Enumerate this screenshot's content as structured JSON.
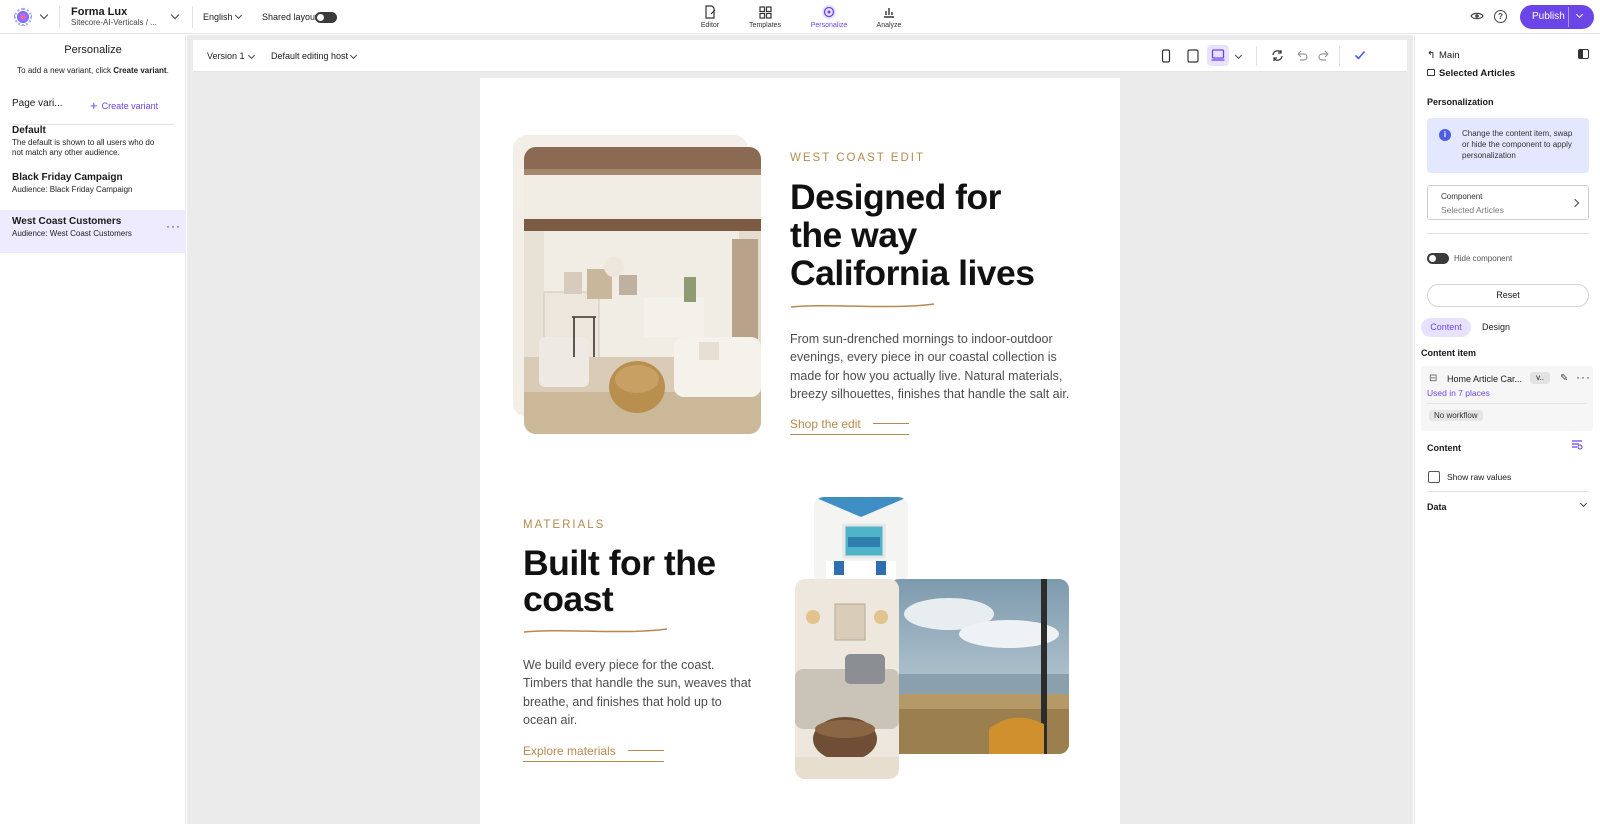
{
  "topbar": {
    "site_name": "Forma Lux",
    "site_path": "Sitecore-AI-Verticals / ...",
    "language": "English",
    "shared_layout_label": "Shared layout",
    "nav": [
      {
        "label": "Editor",
        "icon": "editor-icon"
      },
      {
        "label": "Templates",
        "icon": "templates-icon"
      },
      {
        "label": "Personalize",
        "icon": "personalize-icon",
        "active": true
      },
      {
        "label": "Analyze",
        "icon": "analyze-icon"
      }
    ],
    "publish_label": "Publish",
    "accent_color": "#6c45e8"
  },
  "left_panel": {
    "title": "Personalize",
    "hint_prefix": "To add a new variant, click ",
    "hint_bold": "Create variant",
    "hint_suffix": ".",
    "page_variants_label": "Page vari...",
    "create_variant_label": "Create variant",
    "variants": [
      {
        "name": "Default",
        "description": "The default is shown to all users who do not match any other audience."
      },
      {
        "name": "Black Friday Campaign",
        "description": "Audience: Black Friday Campaign"
      },
      {
        "name": "West Coast Customers",
        "description": "Audience: West Coast Customers",
        "selected": true
      }
    ]
  },
  "canvas": {
    "version_label": "Version 1",
    "host_label": "Default editing host"
  },
  "page": {
    "section1": {
      "eyebrow": "WEST COAST EDIT",
      "heading_lines": [
        "Designed for",
        "the way",
        "California lives"
      ],
      "body": "From sun-drenched mornings to indoor-outdoor evenings, every piece in our coastal collection is made for how you actually live. Natural materials, breezy silhouettes, finishes that handle the salt air.",
      "cta": "Shop the edit"
    },
    "section2": {
      "eyebrow": "MATERIALS",
      "heading_lines": [
        "Built for the",
        "coast"
      ],
      "body": "We build every piece for the coast. Timbers that handle the sun, weaves that breathe, and finishes that hold up to ocean air.",
      "cta": "Explore materials"
    },
    "accent_color": "#b68a4e"
  },
  "right_panel": {
    "breadcrumb": "Main",
    "selected": "Selected Articles",
    "personalization_heading": "Personalization",
    "info_text": "Change the content item, swap or hide the component to apply personalization",
    "component_label": "Component",
    "component_value": "Selected Articles",
    "hide_component_label": "Hide component",
    "reset_label": "Reset",
    "tabs": [
      "Content",
      "Design"
    ],
    "content_item_heading": "Content item",
    "content_item_name": "Home Article Car...",
    "content_item_tag": "v..",
    "used_in": "Used in 7 places",
    "workflow": "No workflow",
    "content_heading": "Content",
    "show_raw_values": "Show raw values",
    "data_label": "Data"
  }
}
